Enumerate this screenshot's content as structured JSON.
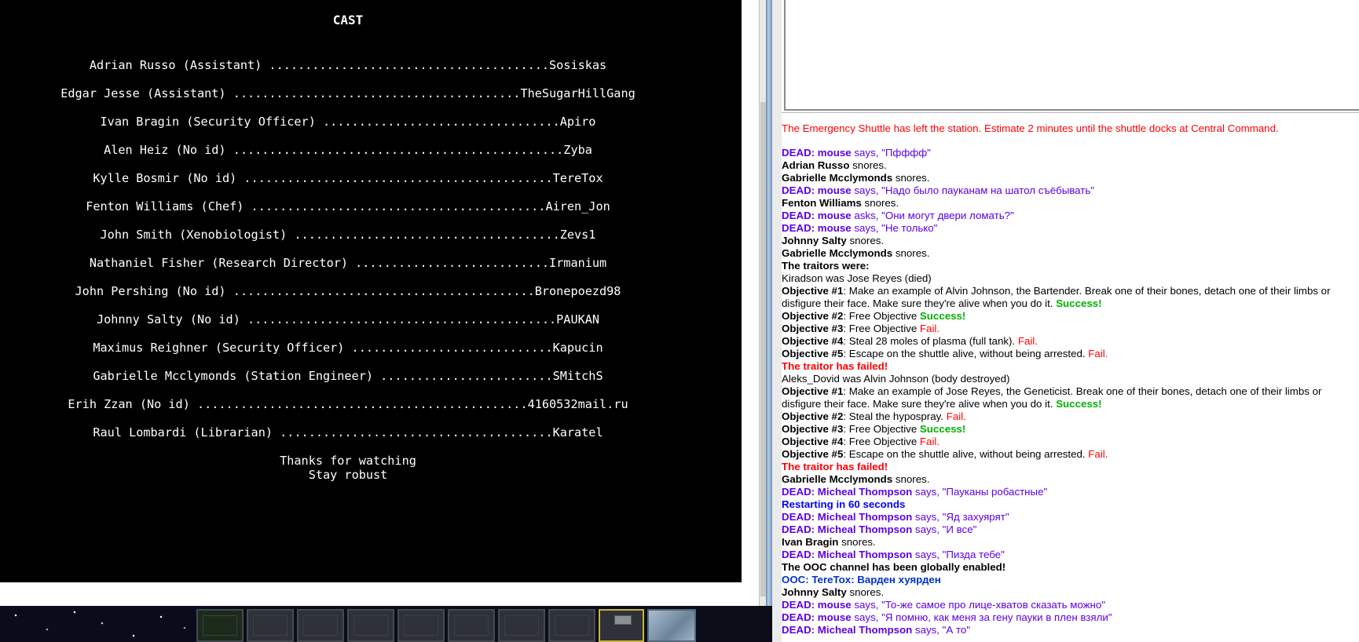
{
  "credits": {
    "title": "CAST",
    "cast": [
      {
        "character": "Adrian Russo",
        "job": "Assistant",
        "player": "Sosiskas"
      },
      {
        "character": "Edgar Jesse",
        "job": "Assistant",
        "player": "TheSugarHillGang"
      },
      {
        "character": "Ivan Bragin",
        "job": "Security Officer",
        "player": "Apiro"
      },
      {
        "character": "Alen Heiz",
        "job": "No id",
        "player": "Zyba"
      },
      {
        "character": "Kylle Bosmir",
        "job": "No id",
        "player": "TereTox"
      },
      {
        "character": "Fenton Williams",
        "job": "Chef",
        "player": "Airen_Jon"
      },
      {
        "character": "John Smith",
        "job": "Xenobiologist",
        "player": "Zevs1"
      },
      {
        "character": "Nathaniel Fisher",
        "job": "Research Director",
        "player": "Irmanium"
      },
      {
        "character": "John Pershing",
        "job": "No id",
        "player": "Bronepoezd98"
      },
      {
        "character": "Johnny Salty",
        "job": "No id",
        "player": "PAUKAN"
      },
      {
        "character": "Maximus Reighner",
        "job": "Security Officer",
        "player": "Kapucin"
      },
      {
        "character": "Gabrielle Mcclymonds",
        "job": "Station Engineer",
        "player": "SMitchS"
      },
      {
        "character": "Erih Zzan",
        "job": "No id",
        "player": "4160532mail.ru"
      },
      {
        "character": "Raul Lombardi",
        "job": "Librarian",
        "player": "Karatel"
      }
    ],
    "cast_lines": [
      "Adrian Russo (Assistant) .......................................Sosiskas",
      "Edgar Jesse (Assistant) ........................................TheSugarHillGang",
      "Ivan Bragin (Security Officer) .................................Apiro",
      "Alen Heiz (No id) ..............................................Zyba",
      "Kylle Bosmir (No id) ...........................................TereTox",
      "Fenton Williams (Chef) .........................................Airen_Jon",
      "John Smith (Xenobiologist) .....................................Zevs1",
      "Nathaniel Fisher (Research Director) ...........................Irmanium",
      "John Pershing (No id) ..........................................Bronepoezd98",
      "Johnny Salty (No id) ...........................................PAUKAN",
      "Maximus Reighner (Security Officer) ............................Kapucin",
      "Gabrielle Mcclymonds (Station Engineer) ........................SMitchS",
      "Erih Zzan (No id) ..............................................4160532mail.ru",
      "Raul Lombardi (Librarian) ......................................Karatel"
    ],
    "thanks": "Thanks for watching",
    "stay": "Stay robust"
  },
  "chat": [
    {
      "type": "announce",
      "text": "The Emergency Shuttle has left the station. Estimate 2 minutes until the shuttle docks at Central Command."
    },
    {
      "type": "dead",
      "speaker": "DEAD: mouse",
      "verb": "says,",
      "text": "\"Пфффф\""
    },
    {
      "type": "emote",
      "speaker": "Adrian Russo",
      "text": "snores."
    },
    {
      "type": "emote",
      "speaker": "Gabrielle Mcclymonds",
      "text": "snores."
    },
    {
      "type": "dead",
      "speaker": "DEAD: mouse",
      "verb": "says,",
      "text": "\"Надо было пауканам на шатол съёбывать\""
    },
    {
      "type": "emote",
      "speaker": "Fenton Williams",
      "text": "snores."
    },
    {
      "type": "dead",
      "speaker": "DEAD: mouse",
      "verb": "asks,",
      "text": "\"Они могут двери ломать?\""
    },
    {
      "type": "dead",
      "speaker": "DEAD: mouse",
      "verb": "says,",
      "text": "\"Не только\""
    },
    {
      "type": "emote",
      "speaker": "Johnny Salty",
      "text": "snores."
    },
    {
      "type": "emote",
      "speaker": "Gabrielle Mcclymonds",
      "text": "snores."
    },
    {
      "type": "heading",
      "text": "The traitors were:"
    },
    {
      "type": "plain",
      "text": "Kiradson was Jose Reyes (died)"
    },
    {
      "type": "objective",
      "label": "Objective #1",
      "text": ": Make an example of Alvin Johnson, the Bartender. Break one of their bones, detach one of their limbs or disfigure their face. Make sure they're alive when you do it.",
      "result": "Success!",
      "result_type": "success"
    },
    {
      "type": "objective",
      "label": "Objective #2",
      "text": ": Free Objective",
      "result": "Success!",
      "result_type": "success"
    },
    {
      "type": "objective",
      "label": "Objective #3",
      "text": ": Free Objective",
      "result": "Fail.",
      "result_type": "fail"
    },
    {
      "type": "objective",
      "label": "Objective #4",
      "text": ": Steal 28 moles of plasma (full tank).",
      "result": "Fail.",
      "result_type": "fail"
    },
    {
      "type": "objective",
      "label": "Objective #5",
      "text": ": Escape on the shuttle alive, without being arrested.",
      "result": "Fail.",
      "result_type": "fail"
    },
    {
      "type": "failed",
      "text": "The traitor has failed!"
    },
    {
      "type": "plain",
      "text": "Aleks_Dovid was Alvin Johnson (body destroyed)"
    },
    {
      "type": "objective",
      "label": "Objective #1",
      "text": ": Make an example of Jose Reyes, the Geneticist. Break one of their bones, detach one of their limbs or disfigure their face. Make sure they're alive when you do it.",
      "result": "Success!",
      "result_type": "success"
    },
    {
      "type": "objective",
      "label": "Objective #2",
      "text": ": Steal the hypospray.",
      "result": "Fail.",
      "result_type": "fail"
    },
    {
      "type": "objective",
      "label": "Objective #3",
      "text": ": Free Objective",
      "result": "Success!",
      "result_type": "success"
    },
    {
      "type": "objective",
      "label": "Objective #4",
      "text": ": Free Objective",
      "result": "Fail.",
      "result_type": "fail"
    },
    {
      "type": "objective",
      "label": "Objective #5",
      "text": ": Escape on the shuttle alive, without being arrested.",
      "result": "Fail.",
      "result_type": "fail"
    },
    {
      "type": "failed",
      "text": "The traitor has failed!"
    },
    {
      "type": "emote",
      "speaker": "Gabrielle Mcclymonds",
      "text": "snores."
    },
    {
      "type": "dead",
      "speaker": "DEAD: Micheal Thompson",
      "verb": "says,",
      "text": "\"Пауканы робастные\""
    },
    {
      "type": "restart",
      "text": "Restarting in 60 seconds"
    },
    {
      "type": "dead",
      "speaker": "DEAD: Micheal Thompson",
      "verb": "says,",
      "text": "\"Яд захуярят\""
    },
    {
      "type": "dead",
      "speaker": "DEAD: Micheal Thompson",
      "verb": "says,",
      "text": "\"И все\""
    },
    {
      "type": "emote",
      "speaker": "Ivan Bragin",
      "text": "snores."
    },
    {
      "type": "dead",
      "speaker": "DEAD: Micheal Thompson",
      "verb": "says,",
      "text": "\"Пизда тебе\""
    },
    {
      "type": "heading",
      "text": "The OOC channel has been globally enabled!"
    },
    {
      "type": "ooc",
      "text": "OOC: TereTox: Варден хуярден"
    },
    {
      "type": "emote",
      "speaker": "Johnny Salty",
      "text": "snores."
    },
    {
      "type": "dead",
      "speaker": "DEAD: mouse",
      "verb": "says,",
      "text": "\"То-же самое про лице-хватов сказать можно\""
    },
    {
      "type": "dead",
      "speaker": "DEAD: mouse",
      "verb": "says,",
      "text": "\"Я помню, как меня за гену пауки в плен взяли\""
    },
    {
      "type": "dead",
      "speaker": "DEAD: Micheal Thompson",
      "verb": "says,",
      "text": "\"А то\""
    }
  ],
  "colors": {
    "dead": "#5c00e6",
    "fail": "#ff0000",
    "success": "#00b000",
    "restart": "#0000ff",
    "ooc": "#0033cc"
  }
}
